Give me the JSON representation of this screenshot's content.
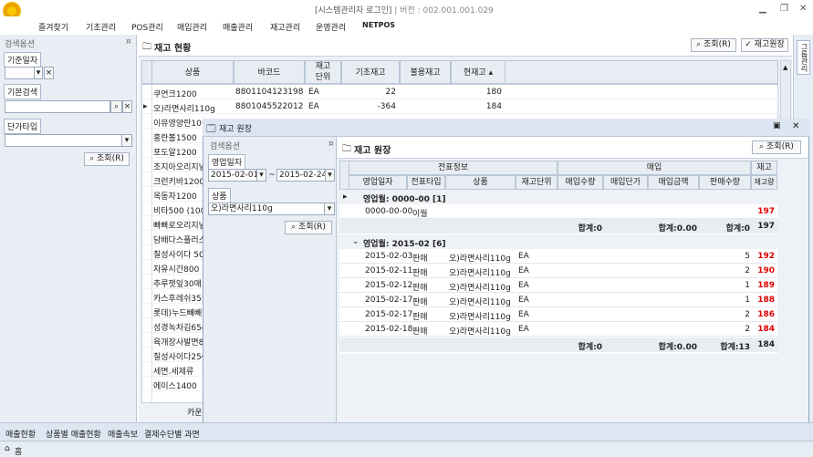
{
  "app": {
    "title": "[시스템관리자 로그인]",
    "version": "| 버전 : 002.001.001.029",
    "menu": [
      "즐겨찾기",
      "기초관리",
      "POS관리",
      "매입관리",
      "매출관리",
      "재고관리",
      "운영관리",
      "NETPOS"
    ]
  },
  "left_panel": {
    "header": "검색옵션",
    "base_date_label": "기준일자",
    "basic_search_label": "기본검색",
    "price_type_label": "단가타입",
    "search_btn": "조회(R)"
  },
  "main": {
    "title": "재고 현황",
    "search_btn": "조회(R)",
    "ledger_btn": "재고원장",
    "columns": [
      "상품",
      "바코드",
      "재고\n단위",
      "기초재고",
      "불용재고",
      "현재고"
    ],
    "rows": [
      {
        "name": "쿠연크1200",
        "barcode": "8801104123198",
        "unit": "EA",
        "begin": "22",
        "unused": "",
        "cur": "180"
      },
      {
        "name": "오)라면사리110g",
        "barcode": "8801045522012",
        "unit": "EA",
        "begin": "-364",
        "unused": "",
        "cur": "184"
      },
      {
        "name": "이뮤영양란10구",
        "barcode": "",
        "unit": "",
        "begin": "",
        "unused": "",
        "cur": ""
      },
      {
        "name": "홍란볼1500",
        "barcode": "",
        "unit": "",
        "begin": "",
        "unused": "",
        "cur": ""
      },
      {
        "name": "포도알1200",
        "barcode": "",
        "unit": "",
        "begin": "",
        "unused": "",
        "cur": ""
      },
      {
        "name": "조지아오리지널",
        "barcode": "",
        "unit": "",
        "begin": "",
        "unused": "",
        "cur": ""
      },
      {
        "name": "크런키바1200",
        "barcode": "",
        "unit": "",
        "begin": "",
        "unused": "",
        "cur": ""
      },
      {
        "name": "옥동자1200",
        "barcode": "",
        "unit": "",
        "begin": "",
        "unused": "",
        "cur": ""
      },
      {
        "name": "비타500 (100m",
        "barcode": "",
        "unit": "",
        "begin": "",
        "unused": "",
        "cur": ""
      },
      {
        "name": "빠빠로오리지널",
        "barcode": "",
        "unit": "",
        "begin": "",
        "unused": "",
        "cur": ""
      },
      {
        "name": "담배다스플러스",
        "barcode": "",
        "unit": "",
        "begin": "",
        "unused": "",
        "cur": ""
      },
      {
        "name": "칠성사이다 50",
        "barcode": "",
        "unit": "",
        "begin": "",
        "unused": "",
        "cur": ""
      },
      {
        "name": "자유시간800",
        "barcode": "",
        "unit": "",
        "begin": "",
        "unused": "",
        "cur": ""
      },
      {
        "name": "추루잿잎30매",
        "barcode": "",
        "unit": "",
        "begin": "",
        "unused": "",
        "cur": ""
      },
      {
        "name": "카스후레쉬355",
        "barcode": "",
        "unit": "",
        "begin": "",
        "unused": "",
        "cur": ""
      },
      {
        "name": "롯데)누드빼빼",
        "barcode": "",
        "unit": "",
        "begin": "",
        "unused": "",
        "cur": ""
      },
      {
        "name": "성경녹차김65g",
        "barcode": "",
        "unit": "",
        "begin": "",
        "unused": "",
        "cur": ""
      },
      {
        "name": "육개장사발면8",
        "barcode": "",
        "unit": "",
        "begin": "",
        "unused": "",
        "cur": ""
      },
      {
        "name": "칠성사이다250",
        "barcode": "",
        "unit": "",
        "begin": "",
        "unused": "",
        "cur": ""
      },
      {
        "name": "세면.세제류",
        "barcode": "",
        "unit": "",
        "begin": "",
        "unused": "",
        "cur": ""
      },
      {
        "name": "에이스1400",
        "barcode": "",
        "unit": "",
        "begin": "",
        "unused": "",
        "cur": ""
      }
    ],
    "footer_label": "카운"
  },
  "dialog": {
    "title": "재고 원장",
    "options_header": "검색옵션",
    "date_label": "영업일자",
    "date_from": "2015-02-01",
    "date_sep": "~",
    "date_to": "2015-02-24",
    "product_label": "상품",
    "product_value": "오)라면사리110g",
    "search_btn": "조회(R)",
    "ledger_title": "재고 원장",
    "ledger_search_btn": "조회(R)",
    "group_headers": [
      "전표정보",
      "매입",
      "재고"
    ],
    "columns": [
      "영업일자",
      "전표타입",
      "상품",
      "재고단위",
      "매입수량",
      "매입단가",
      "매입금액",
      "판매수량",
      "재고량"
    ],
    "group1": {
      "label": "영업월: 0000-00 [1]",
      "rows": [
        {
          "date": "0000-00-00",
          "type": "이월",
          "product": "",
          "unit": "",
          "stock": "197"
        }
      ],
      "sum": {
        "buy": "합계:0",
        "amt": "합계:0.00",
        "sale": "합계:0",
        "stock": "197"
      }
    },
    "group2": {
      "label": "영업월: 2015-02 [6]",
      "rows": [
        {
          "date": "2015-02-03",
          "type": "판매",
          "product": "오)라면사리110g",
          "unit": "EA",
          "sale": "5",
          "stock": "192"
        },
        {
          "date": "2015-02-11",
          "type": "판매",
          "product": "오)라면사리110g",
          "unit": "EA",
          "sale": "2",
          "stock": "190"
        },
        {
          "date": "2015-02-12",
          "type": "판매",
          "product": "오)라면사리110g",
          "unit": "EA",
          "sale": "1",
          "stock": "189"
        },
        {
          "date": "2015-02-17",
          "type": "판매",
          "product": "오)라면사리110g",
          "unit": "EA",
          "sale": "1",
          "stock": "188"
        },
        {
          "date": "2015-02-17",
          "type": "판매",
          "product": "오)라면사리110g",
          "unit": "EA",
          "sale": "2",
          "stock": "186"
        },
        {
          "date": "2015-02-18",
          "type": "판매",
          "product": "오)라면사리110g",
          "unit": "EA",
          "sale": "2",
          "stock": "184"
        }
      ],
      "sum": {
        "buy": "합계:0",
        "amt": "합계:0.00",
        "sale": "합계:13",
        "stock": "184"
      }
    }
  },
  "bottom_tabs": [
    "매출현황",
    "상품별 매출현황",
    "매출속보",
    "결제수단별 과면"
  ],
  "status": {
    "home": "홈"
  },
  "sidebar_text": "그룹관리"
}
